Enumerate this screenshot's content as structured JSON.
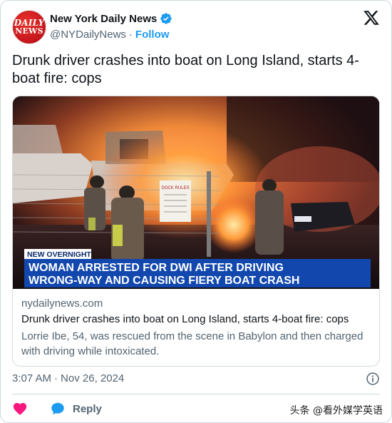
{
  "account": {
    "name": "New York Daily News",
    "handle": "@NYDailyNews",
    "separator": "·",
    "follow_label": "Follow",
    "avatar_line1": "DAILY",
    "avatar_line2": "NEWS"
  },
  "tweet": {
    "text": "Drunk driver crashes into boat on Long Island, starts 4-boat fire: cops"
  },
  "media": {
    "banner_tag": "NEW OVERNIGHT",
    "banner_line1": "WOMAN ARRESTED FOR DWI AFTER DRIVING",
    "banner_line2": "WRONG-WAY AND CAUSING FIERY BOAT CRASH",
    "sign_text": "DOCK RULES"
  },
  "link_card": {
    "domain": "nydailynews.com",
    "title": "Drunk driver crashes into boat on Long Island, starts 4-boat fire: cops",
    "description": "Lorrie Ibe, 54, was rescued from the scene in Babylon and then charged with driving while intoxicated."
  },
  "timestamp": {
    "time": "3:07 AM",
    "separator": "·",
    "date": "Nov 26, 2024"
  },
  "actions": {
    "reply_label": "Reply"
  },
  "watermark": {
    "text": "头条 @看外媒学英语"
  },
  "colors": {
    "accent": "#1d9bf0",
    "heart": "#f91880",
    "text_secondary": "#536471",
    "border": "#cfd9de"
  }
}
